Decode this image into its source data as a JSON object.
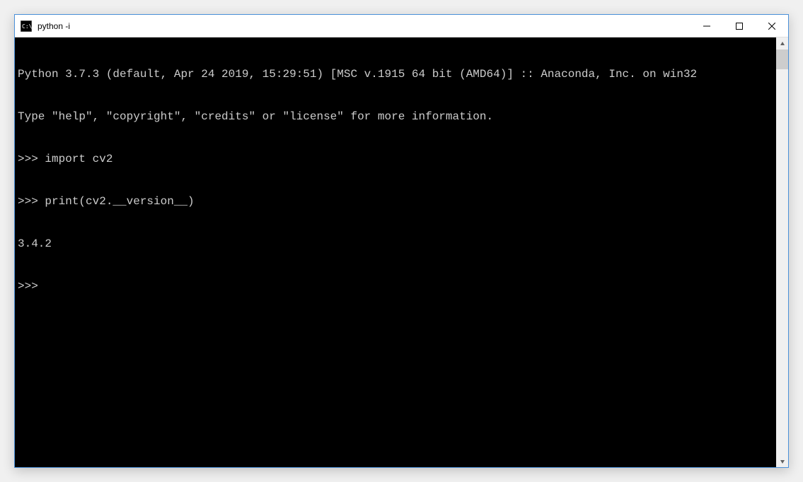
{
  "window": {
    "title": "python  -i"
  },
  "terminal": {
    "lines": [
      "Python 3.7.3 (default, Apr 24 2019, 15:29:51) [MSC v.1915 64 bit (AMD64)] :: Anaconda, Inc. on win32",
      "Type \"help\", \"copyright\", \"credits\" or \"license\" for more information.",
      ">>> import cv2",
      ">>> print(cv2.__version__)",
      "3.4.2",
      ">>> "
    ]
  }
}
